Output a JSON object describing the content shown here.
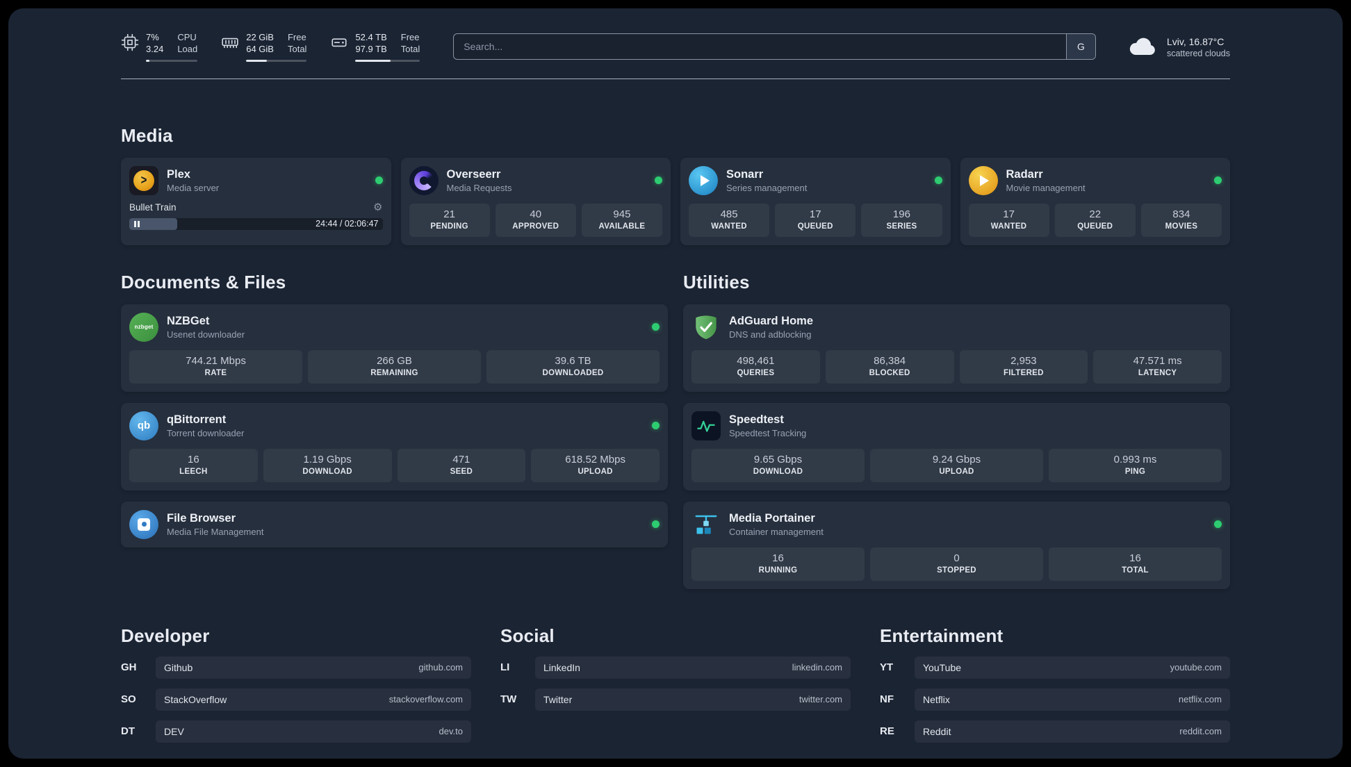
{
  "colors": {
    "status_online": "#2ecc71"
  },
  "topbar": {
    "resources": [
      {
        "icon": "cpu-icon",
        "value_top": "7%",
        "value_bottom": "3.24",
        "label_top": "CPU",
        "label_bottom": "Load",
        "percent": 7
      },
      {
        "icon": "memory-icon",
        "value_top": "22 GiB",
        "value_bottom": "64 GiB",
        "label_top": "Free",
        "label_bottom": "Total",
        "percent": 34
      },
      {
        "icon": "disk-icon",
        "value_top": "52.4 TB",
        "value_bottom": "97.9 TB",
        "label_top": "Free",
        "label_bottom": "Total",
        "percent": 54
      }
    ],
    "search": {
      "placeholder": "Search...",
      "provider_label": "G"
    },
    "weather": {
      "location": "Lviv, 16.87°C",
      "condition": "scattered clouds"
    }
  },
  "groups": {
    "media": {
      "title": "Media",
      "services": [
        {
          "name": "Plex",
          "description": "Media server",
          "status": "online",
          "icon_label": ">",
          "player": {
            "track": "Bullet Train",
            "time": "24:44 / 02:06:47",
            "progress_percent": 19
          }
        },
        {
          "name": "Overseerr",
          "description": "Media Requests",
          "status": "online",
          "stats": [
            {
              "value": "21",
              "label": "PENDING"
            },
            {
              "value": "40",
              "label": "APPROVED"
            },
            {
              "value": "945",
              "label": "AVAILABLE"
            }
          ]
        },
        {
          "name": "Sonarr",
          "description": "Series management",
          "status": "online",
          "stats": [
            {
              "value": "485",
              "label": "WANTED"
            },
            {
              "value": "17",
              "label": "QUEUED"
            },
            {
              "value": "196",
              "label": "SERIES"
            }
          ]
        },
        {
          "name": "Radarr",
          "description": "Movie management",
          "status": "online",
          "stats": [
            {
              "value": "17",
              "label": "WANTED"
            },
            {
              "value": "22",
              "label": "QUEUED"
            },
            {
              "value": "834",
              "label": "MOVIES"
            }
          ]
        }
      ]
    },
    "documents": {
      "title": "Documents & Files",
      "services": [
        {
          "name": "NZBGet",
          "description": "Usenet downloader",
          "status": "online",
          "icon_label": "nzbget",
          "stats": [
            {
              "value": "744.21 Mbps",
              "label": "RATE"
            },
            {
              "value": "266 GB",
              "label": "REMAINING"
            },
            {
              "value": "39.6 TB",
              "label": "DOWNLOADED"
            }
          ]
        },
        {
          "name": "qBittorrent",
          "description": "Torrent downloader",
          "status": "online",
          "icon_label": "qb",
          "stats": [
            {
              "value": "16",
              "label": "LEECH"
            },
            {
              "value": "1.19 Gbps",
              "label": "DOWNLOAD"
            },
            {
              "value": "471",
              "label": "SEED"
            },
            {
              "value": "618.52 Mbps",
              "label": "UPLOAD"
            }
          ]
        },
        {
          "name": "File Browser",
          "description": "Media File Management",
          "status": "online"
        }
      ]
    },
    "utilities": {
      "title": "Utilities",
      "services": [
        {
          "name": "AdGuard Home",
          "description": "DNS and adblocking",
          "stats": [
            {
              "value": "498,461",
              "label": "QUERIES"
            },
            {
              "value": "86,384",
              "label": "BLOCKED"
            },
            {
              "value": "2,953",
              "label": "FILTERED"
            },
            {
              "value": "47.571 ms",
              "label": "LATENCY"
            }
          ]
        },
        {
          "name": "Speedtest",
          "description": "Speedtest Tracking",
          "stats": [
            {
              "value": "9.65 Gbps",
              "label": "DOWNLOAD"
            },
            {
              "value": "9.24 Gbps",
              "label": "UPLOAD"
            },
            {
              "value": "0.993 ms",
              "label": "PING"
            }
          ]
        },
        {
          "name": "Media Portainer",
          "description": "Container management",
          "status": "online",
          "stats": [
            {
              "value": "16",
              "label": "RUNNING"
            },
            {
              "value": "0",
              "label": "STOPPED"
            },
            {
              "value": "16",
              "label": "TOTAL"
            }
          ]
        }
      ]
    }
  },
  "bookmarks": [
    {
      "title": "Developer",
      "items": [
        {
          "abbr": "GH",
          "name": "Github",
          "domain": "github.com"
        },
        {
          "abbr": "SO",
          "name": "StackOverflow",
          "domain": "stackoverflow.com"
        },
        {
          "abbr": "DT",
          "name": "DEV",
          "domain": "dev.to"
        }
      ]
    },
    {
      "title": "Social",
      "items": [
        {
          "abbr": "LI",
          "name": "LinkedIn",
          "domain": "linkedin.com"
        },
        {
          "abbr": "TW",
          "name": "Twitter",
          "domain": "twitter.com"
        }
      ]
    },
    {
      "title": "Entertainment",
      "items": [
        {
          "abbr": "YT",
          "name": "YouTube",
          "domain": "youtube.com"
        },
        {
          "abbr": "NF",
          "name": "Netflix",
          "domain": "netflix.com"
        },
        {
          "abbr": "RE",
          "name": "Reddit",
          "domain": "reddit.com"
        }
      ]
    }
  ]
}
